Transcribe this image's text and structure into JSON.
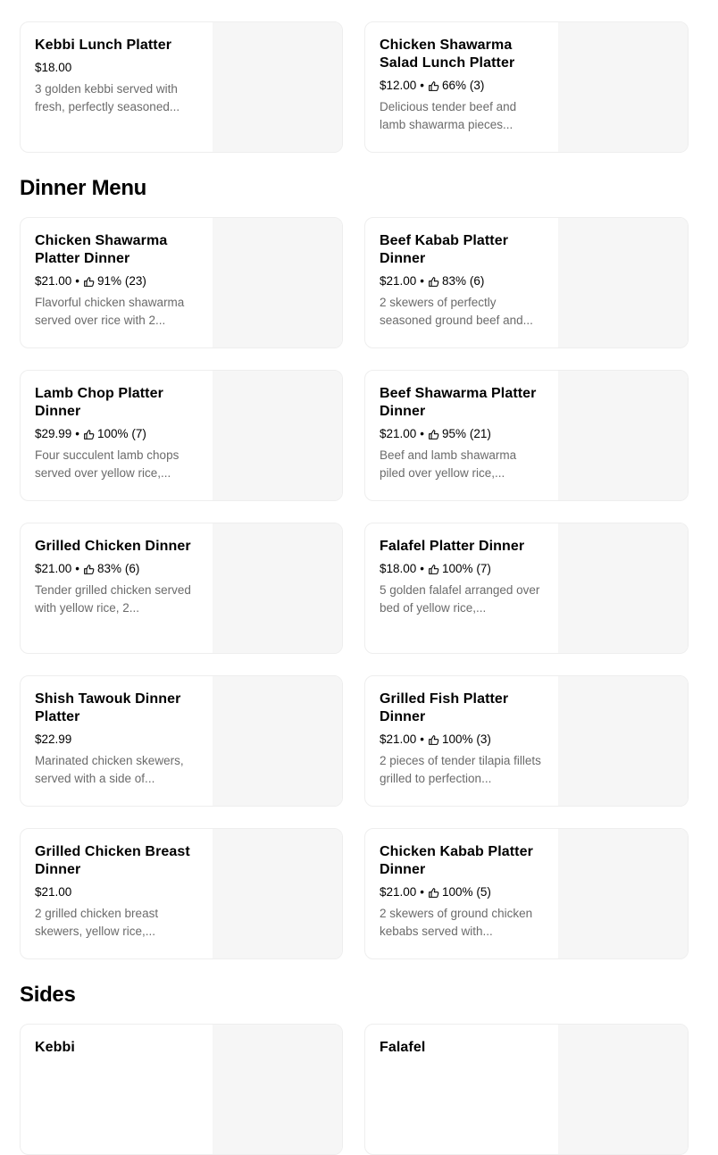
{
  "sections": {
    "dinner_title": "Dinner Menu",
    "sides_title": "Sides"
  },
  "icons": {
    "rating": "thumbs-up-icon"
  },
  "items": [
    {
      "title": "Kebbi Lunch Platter",
      "price": "$18.00",
      "rating": "",
      "reviews": "",
      "desc": "3 golden kebbi served with fresh, perfectly seasoned..."
    },
    {
      "title": "Chicken Shawarma Salad Lunch Platter",
      "price": "$12.00",
      "rating": "66%",
      "reviews": "(3)",
      "desc": "Delicious tender beef and lamb shawarma pieces..."
    },
    {
      "title": "Chicken Shawarma Platter Dinner",
      "price": "$21.00",
      "rating": "91%",
      "reviews": "(23)",
      "desc": "Flavorful chicken shawarma served over rice with 2..."
    },
    {
      "title": "Beef Kabab Platter Dinner",
      "price": "$21.00",
      "rating": "83%",
      "reviews": "(6)",
      "desc": "2 skewers of perfectly seasoned ground beef and..."
    },
    {
      "title": "Lamb Chop Platter Dinner",
      "price": "$29.99",
      "rating": "100%",
      "reviews": "(7)",
      "desc": "Four succulent lamb chops served over yellow rice,..."
    },
    {
      "title": "Beef Shawarma Platter Dinner",
      "price": "$21.00",
      "rating": "95%",
      "reviews": "(21)",
      "desc": "Beef and lamb shawarma piled over yellow rice,..."
    },
    {
      "title": "Grilled Chicken Dinner",
      "price": "$21.00",
      "rating": "83%",
      "reviews": "(6)",
      "desc": "Tender grilled chicken served with yellow rice, 2..."
    },
    {
      "title": "Falafel Platter Dinner",
      "price": "$18.00",
      "rating": "100%",
      "reviews": "(7)",
      "desc": "5 golden falafel arranged over bed of yellow rice,..."
    },
    {
      "title": "Shish Tawouk  Dinner Platter",
      "price": "$22.99",
      "rating": "",
      "reviews": "",
      "desc": "Marinated chicken skewers, served with a side of..."
    },
    {
      "title": "Grilled Fish Platter Dinner",
      "price": "$21.00",
      "rating": "100%",
      "reviews": "(3)",
      "desc": "2 pieces of tender tilapia fillets grilled to perfection..."
    },
    {
      "title": "Grilled Chicken Breast Dinner",
      "price": "$21.00",
      "rating": "",
      "reviews": "",
      "desc": "2 grilled chicken breast skewers, yellow rice,..."
    },
    {
      "title": "Chicken Kabab Platter Dinner",
      "price": "$21.00",
      "rating": "100%",
      "reviews": "(5)",
      "desc": "2 skewers of ground chicken kebabs served with..."
    },
    {
      "title": "Kebbi",
      "price": "",
      "rating": "",
      "reviews": "",
      "desc": ""
    },
    {
      "title": "Falafel",
      "price": "",
      "rating": "",
      "reviews": "",
      "desc": ""
    }
  ]
}
